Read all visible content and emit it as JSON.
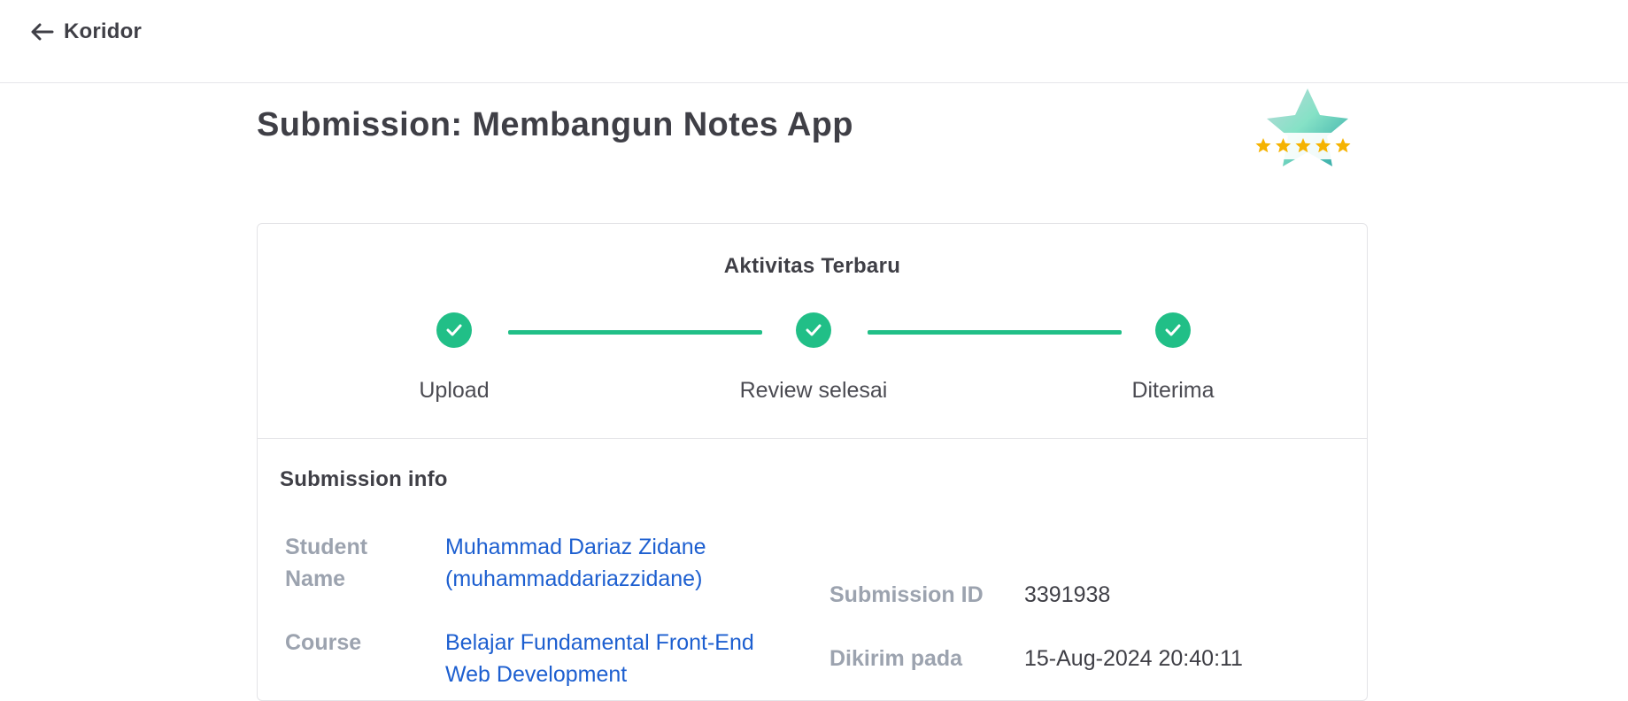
{
  "nav": {
    "back_label": "Koridor"
  },
  "page": {
    "title": "Submission: Membangun Notes App"
  },
  "rating": {
    "stars": 5,
    "max_stars": 5
  },
  "activity": {
    "title": "Aktivitas Terbaru",
    "steps": [
      {
        "label": "Upload",
        "status": "done"
      },
      {
        "label": "Review selesai",
        "status": "done"
      },
      {
        "label": "Diterima",
        "status": "done"
      }
    ]
  },
  "submission_info": {
    "title": "Submission info",
    "student_label_line1": "Student",
    "student_label_line2": "Name",
    "student_name_line1": "Muhammad Dariaz Zidane",
    "student_name_line2": "(muhammaddariazzidane)",
    "course_label": "Course",
    "course_line1": "Belajar Fundamental Front-End",
    "course_line2": "Web Development",
    "submission_id_label": "Submission ID",
    "submission_id": "3391938",
    "sent_label": "Dikirim pada",
    "sent_at": "15-Aug-2024 20:40:11"
  },
  "colors": {
    "accent_green": "#21bf87",
    "link_blue": "#1d5fd0",
    "muted_label": "#9ca3af",
    "star_yellow": "#f5b301"
  }
}
